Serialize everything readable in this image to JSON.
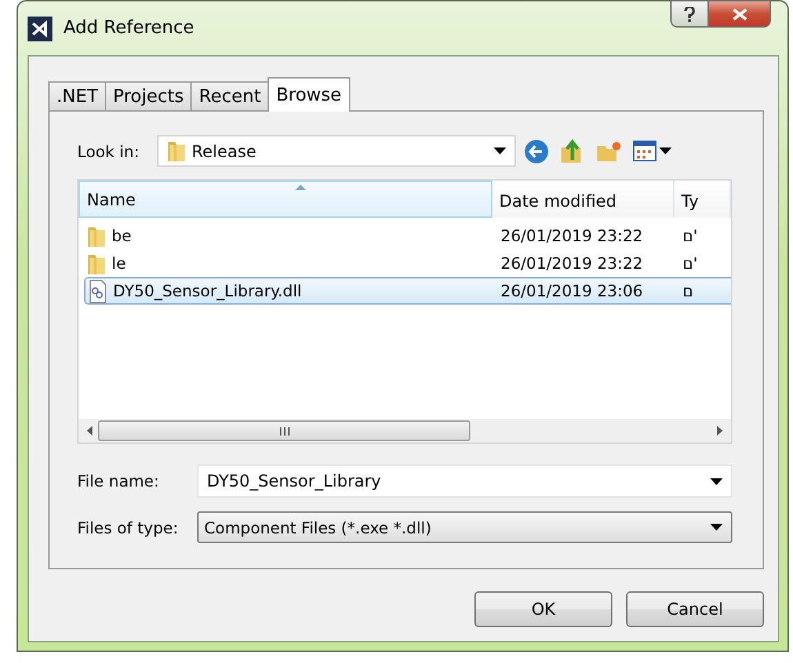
{
  "window": {
    "title": "Add Reference"
  },
  "tabs": [
    {
      "label": ".NET",
      "selected": false
    },
    {
      "label": "Projects",
      "selected": false
    },
    {
      "label": "Recent",
      "selected": false
    },
    {
      "label": "Browse",
      "selected": true
    }
  ],
  "look_in": {
    "label": "Look in:",
    "value": "Release"
  },
  "file_list": {
    "columns": [
      "Name",
      "Date modified",
      "Ty"
    ],
    "rows": [
      {
        "kind": "folder",
        "name": "be",
        "date": "26/01/2019 23:22",
        "type": "ם'",
        "selected": false
      },
      {
        "kind": "folder",
        "name": "le",
        "date": "26/01/2019 23:22",
        "type": "ם'",
        "selected": false
      },
      {
        "kind": "file",
        "name": "DY50_Sensor_Library.dll",
        "date": "26/01/2019 23:06",
        "type": "ם",
        "selected": true
      }
    ]
  },
  "file_name": {
    "label": "File name:",
    "value": "DY50_Sensor_Library"
  },
  "files_of_type": {
    "label": "Files of type:",
    "value": "Component Files (*.exe *.dll)"
  },
  "buttons": [
    "OK",
    "Cancel"
  ]
}
